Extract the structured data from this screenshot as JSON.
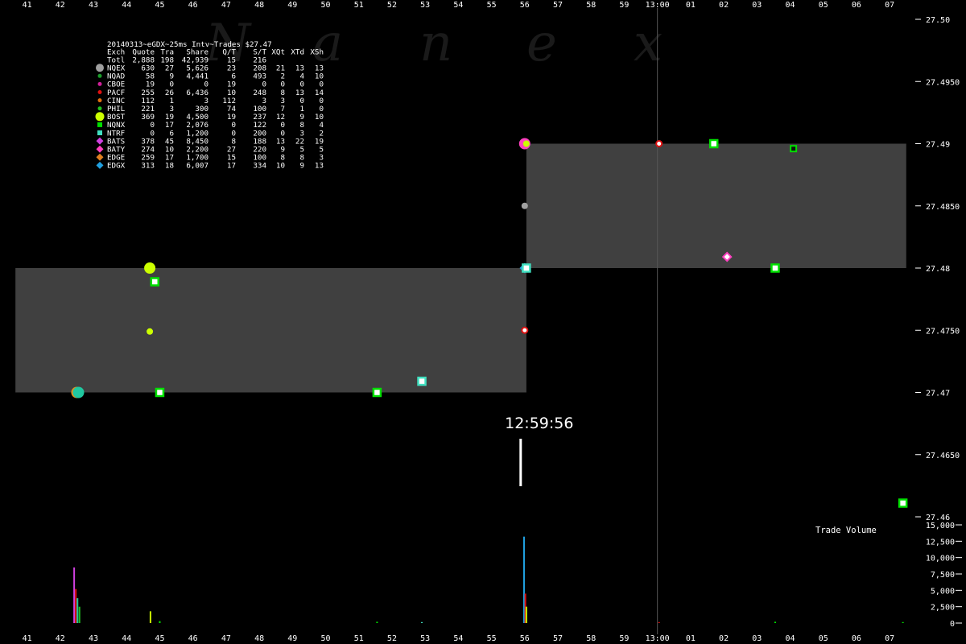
{
  "chart_data": {
    "type": "scatter",
    "title": "20140313~eGDX~25ms Intv~Trades $27.47",
    "watermark": [
      "N",
      "a",
      "n",
      "e",
      "x"
    ],
    "x_ticks": [
      "41",
      "42",
      "43",
      "44",
      "45",
      "46",
      "47",
      "48",
      "49",
      "50",
      "51",
      "52",
      "53",
      "54",
      "55",
      "56",
      "57",
      "58",
      "59",
      "13:00",
      "01",
      "02",
      "03",
      "04",
      "05",
      "06",
      "07"
    ],
    "x_range": [
      40.5,
      67.7
    ],
    "price_ticks": [
      "27.50",
      "27.4950",
      "27.49",
      "27.4850",
      "27.48",
      "27.4750",
      "27.47",
      "27.4650",
      "27.46"
    ],
    "price_range": [
      27.46,
      27.5
    ],
    "volume_ticks": [
      "15,000",
      "12,500",
      "10,000",
      "7,500",
      "5,000",
      "2,500",
      "0"
    ],
    "volume_range": [
      0,
      15000
    ],
    "volume_label": "Trade Volume",
    "annotation": "12:59:56",
    "annotation_x": 56.0,
    "grid": false,
    "stats": {
      "header": [
        "Exch",
        "Quote",
        "Tra",
        "Share",
        "Q/T",
        "S/T",
        "XQt",
        "XTd",
        "XSh"
      ],
      "total": [
        "Totl",
        "2,888",
        "198",
        "42,939",
        "15",
        "216",
        "",
        "",
        ""
      ],
      "rows": [
        {
          "marker": "circle",
          "color": "#a0a0a0",
          "cells": [
            "NQEX",
            "630",
            "27",
            "5,626",
            "23",
            "208",
            "21",
            "13",
            "13"
          ]
        },
        {
          "marker": "dot",
          "color": "#1a9e2a",
          "cells": [
            "NQAD",
            "58",
            "9",
            "4,441",
            "6",
            "493",
            "2",
            "4",
            "10"
          ]
        },
        {
          "marker": "dot",
          "color": "#d0209a",
          "cells": [
            "CBOE",
            "19",
            "0",
            "0",
            "19",
            "0",
            "0",
            "0",
            "0"
          ]
        },
        {
          "marker": "dot",
          "color": "#e01010",
          "cells": [
            "PACF",
            "255",
            "26",
            "6,436",
            "10",
            "248",
            "8",
            "13",
            "14"
          ]
        },
        {
          "marker": "dot",
          "color": "#e07010",
          "cells": [
            "CINC",
            "112",
            "1",
            "3",
            "112",
            "3",
            "3",
            "0",
            "0"
          ]
        },
        {
          "marker": "dot",
          "color": "#20c020",
          "cells": [
            "PHIL",
            "221",
            "3",
            "300",
            "74",
            "100",
            "7",
            "1",
            "0"
          ]
        },
        {
          "marker": "bigdot",
          "color": "#ccff00",
          "cells": [
            "BOST",
            "369",
            "19",
            "4,500",
            "19",
            "237",
            "12",
            "9",
            "10"
          ]
        },
        {
          "marker": "square",
          "color": "#00e000",
          "cells": [
            "NQNX",
            "0",
            "17",
            "2,076",
            "0",
            "122",
            "0",
            "8",
            "4"
          ]
        },
        {
          "marker": "square",
          "color": "#40e0c0",
          "cells": [
            "NTRF",
            "0",
            "6",
            "1,200",
            "0",
            "200",
            "0",
            "3",
            "2"
          ]
        },
        {
          "marker": "diamond",
          "color": "#d040e0",
          "cells": [
            "BATS",
            "378",
            "45",
            "8,450",
            "8",
            "188",
            "13",
            "22",
            "19"
          ]
        },
        {
          "marker": "diamond",
          "color": "#ff40c0",
          "cells": [
            "BATY",
            "274",
            "10",
            "2,200",
            "27",
            "220",
            "9",
            "5",
            "5"
          ]
        },
        {
          "marker": "diamond",
          "color": "#e08020",
          "cells": [
            "EDGE",
            "259",
            "17",
            "1,700",
            "15",
            "100",
            "8",
            "8",
            "3"
          ]
        },
        {
          "marker": "diamond",
          "color": "#20a0e0",
          "cells": [
            "EDGX",
            "313",
            "18",
            "6,007",
            "17",
            "334",
            "10",
            "9",
            "13"
          ]
        }
      ]
    },
    "nbbo_bands": [
      {
        "x_start": 40.65,
        "x_end": 56.05,
        "bid": 27.47,
        "ask": 27.48,
        "color": "#404040"
      },
      {
        "x_start": 56.05,
        "x_end": 67.5,
        "bid": 27.48,
        "ask": 27.49,
        "color": "#404040"
      }
    ],
    "trades": [
      {
        "x": 42.5,
        "price": 27.47,
        "marker": "bigdot",
        "color": "#e09020"
      },
      {
        "x": 42.55,
        "price": 27.47,
        "marker": "bigdot",
        "color": "#20c8a0"
      },
      {
        "x": 44.7,
        "price": 27.48,
        "marker": "bigdot",
        "color": "#ccff00"
      },
      {
        "x": 44.7,
        "price": 27.4749,
        "marker": "dot",
        "color": "#ccff00"
      },
      {
        "x": 44.85,
        "price": 27.4789,
        "marker": "square",
        "color": "#00e000"
      },
      {
        "x": 45.0,
        "price": 27.47,
        "marker": "square",
        "color": "#00e000"
      },
      {
        "x": 51.55,
        "price": 27.47,
        "marker": "square",
        "color": "#00e000"
      },
      {
        "x": 52.9,
        "price": 27.4709,
        "marker": "square",
        "color": "#40e0c0"
      },
      {
        "x": 56.0,
        "price": 27.49,
        "marker": "bigdot",
        "color": "#ff40c0"
      },
      {
        "x": 56.05,
        "price": 27.49,
        "marker": "dot",
        "color": "#ccff00"
      },
      {
        "x": 56.0,
        "price": 27.485,
        "marker": "dot",
        "color": "#a0a0a0"
      },
      {
        "x": 56.0,
        "price": 27.48,
        "marker": "diamond",
        "color": "#20a0e0"
      },
      {
        "x": 56.05,
        "price": 27.48,
        "marker": "square",
        "color": "#40e0c0"
      },
      {
        "x": 56.0,
        "price": 27.475,
        "marker": "ring",
        "color": "#e01010"
      },
      {
        "x": 60.05,
        "price": 27.49,
        "marker": "ring",
        "color": "#e01010"
      },
      {
        "x": 61.7,
        "price": 27.49,
        "marker": "square",
        "color": "#00e000"
      },
      {
        "x": 62.1,
        "price": 27.4809,
        "marker": "diamond",
        "color": "#ff40c0"
      },
      {
        "x": 63.55,
        "price": 27.48,
        "marker": "square",
        "color": "#00e000"
      },
      {
        "x": 64.1,
        "price": 27.4896,
        "marker": "squaresmall",
        "color": "#00e000"
      },
      {
        "x": 67.4,
        "price": 27.4611,
        "marker": "square",
        "color": "#00e000"
      }
    ],
    "volume_bars": [
      {
        "x": 42.42,
        "value": 8500,
        "color": "#d040e0"
      },
      {
        "x": 42.47,
        "value": 5200,
        "color": "#e01010"
      },
      {
        "x": 42.52,
        "value": 3800,
        "color": "#20c8a0"
      },
      {
        "x": 42.58,
        "value": 2500,
        "color": "#20c020"
      },
      {
        "x": 44.72,
        "value": 1800,
        "color": "#ccff00"
      },
      {
        "x": 45.0,
        "value": 300,
        "color": "#00e000"
      },
      {
        "x": 51.55,
        "value": 200,
        "color": "#00e000"
      },
      {
        "x": 52.9,
        "value": 150,
        "color": "#40e0c0"
      },
      {
        "x": 55.98,
        "value": 13200,
        "color": "#20a0e0"
      },
      {
        "x": 56.02,
        "value": 4500,
        "color": "#e01010"
      },
      {
        "x": 56.05,
        "value": 2500,
        "color": "#ccff00"
      },
      {
        "x": 60.05,
        "value": 150,
        "color": "#e01010"
      },
      {
        "x": 63.55,
        "value": 200,
        "color": "#00e000"
      },
      {
        "x": 67.4,
        "value": 150,
        "color": "#00e000"
      }
    ]
  }
}
